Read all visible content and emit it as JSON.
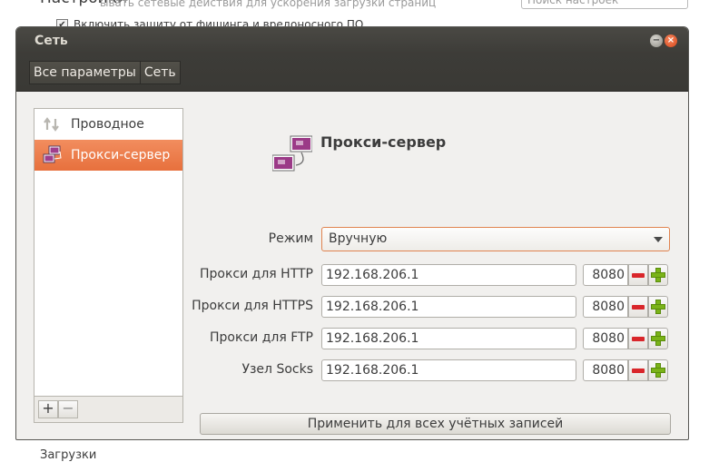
{
  "background": {
    "title": "Настройки",
    "search_placeholder": "Поиск настроек",
    "partial_line": "ывать сетевые действия для ускорения загрузки страниц",
    "phishing_label": "Включить защиту от фишинга и вредоносного ПО",
    "downloads_heading": "Загрузки"
  },
  "dialog": {
    "title": "Сеть",
    "breadcrumb": [
      "Все параметры",
      "Сеть"
    ],
    "sidebar": {
      "items": [
        {
          "label": "Проводное",
          "icon": "wired-network-icon",
          "active": false
        },
        {
          "label": "Прокси-сервер",
          "icon": "proxy-icon",
          "active": true
        }
      ],
      "add_label": "+",
      "remove_label": "−"
    },
    "main": {
      "title": "Прокси-сервер",
      "mode_label": "Режим",
      "mode_value": "Вручную",
      "rows": [
        {
          "label": "Прокси для HTTP",
          "host": "192.168.206.1",
          "port": "8080"
        },
        {
          "label": "Прокси для HTTPS",
          "host": "192.168.206.1",
          "port": "8080"
        },
        {
          "label": "Прокси для FTP",
          "host": "192.168.206.1",
          "port": "8080"
        },
        {
          "label": "Узел Socks",
          "host": "192.168.206.1",
          "port": "8080"
        }
      ],
      "apply_label": "Применить для всех учётных записей"
    }
  },
  "colors": {
    "accent": "#e7703d",
    "titlebar": "#3d3c38",
    "window_bg": "#f1f0ee"
  }
}
